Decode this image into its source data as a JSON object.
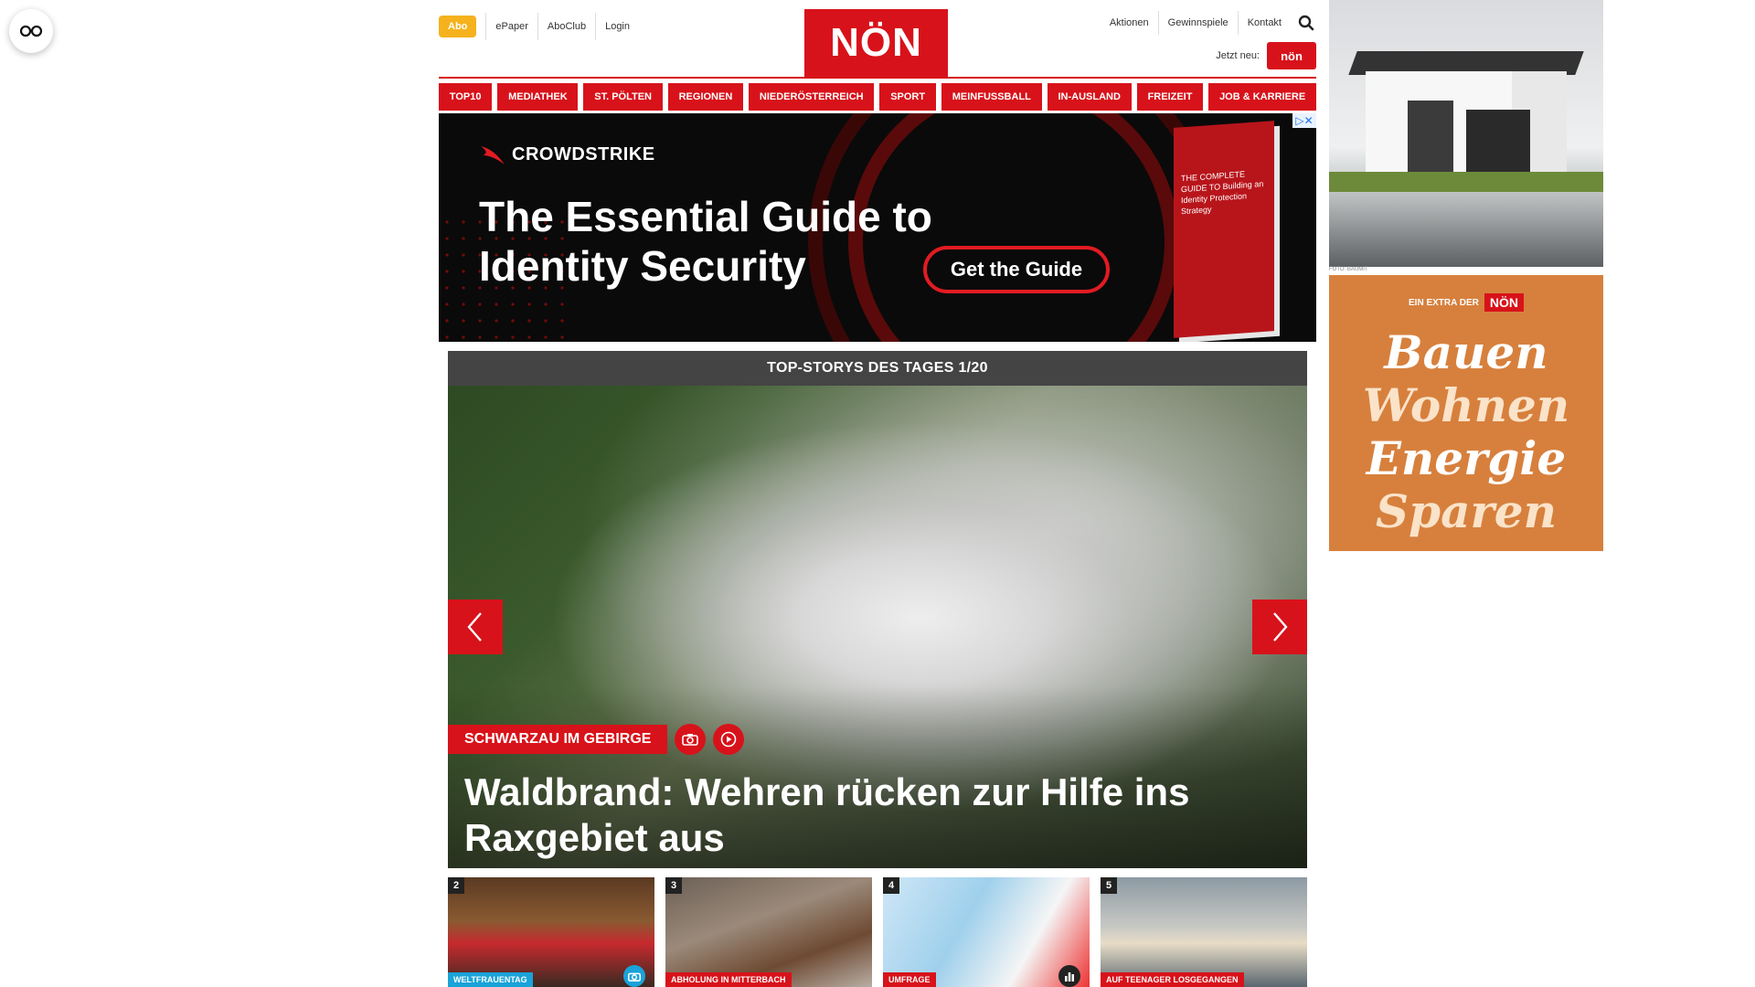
{
  "reader_button": {
    "icon": "glasses-icon"
  },
  "header": {
    "abo_label": "Abo",
    "utility_links": [
      "ePaper",
      "AboClub",
      "Login"
    ],
    "logo_text": "NÖN",
    "right_links": [
      "Aktionen",
      "Gewinnspiele",
      "Kontakt"
    ],
    "jetzt_label": "Jetzt neu:",
    "jetzt_badge": "nön"
  },
  "nav": {
    "items": [
      "TOP10",
      "MEDIATHEK",
      "ST. PÖLTEN",
      "REGIONEN",
      "NIEDERÖSTERREICH",
      "SPORT",
      "MEINFUSSBALL",
      "IN-AUSLAND",
      "FREIZEIT",
      "JOB & KARRIERE"
    ]
  },
  "ad_banner": {
    "brand": "CROWDSTRIKE",
    "headline": "The Essential Guide to Identity Security",
    "cta": "Get the Guide",
    "book_text": "THE COMPLETE GUIDE TO Building an Identity Protection Strategy",
    "choices_label": "▷✕"
  },
  "carousel": {
    "header": "TOP-STORYS DES TAGES 1/20",
    "hero_tag": "SCHWARZAU IM GEBIRGE",
    "hero_title": "Waldbrand: Wehren rücken zur Hilfe ins Raxgebiet aus"
  },
  "teasers": [
    {
      "num": "2",
      "label": "WELTFRAUENTAG",
      "label_color": "blue",
      "icon": "camera-icon"
    },
    {
      "num": "3",
      "label": "ABHOLUNG IN MITTERBACH",
      "label_color": "red",
      "icon": ""
    },
    {
      "num": "4",
      "label": "UMFRAGE",
      "label_color": "red",
      "icon": "bar-chart-icon"
    },
    {
      "num": "5",
      "label": "AUF TEENAGER LOSGEGANGEN",
      "label_color": "red",
      "icon": ""
    }
  ],
  "sidebar": {
    "ad1_caption": "FOTO: BAUMIT",
    "ad2_top": "EIN EXTRA DER",
    "ad2_logo": "NÖN",
    "ad2_words": [
      "Bauen",
      "Wohnen",
      "Energie",
      "Sparen"
    ]
  }
}
